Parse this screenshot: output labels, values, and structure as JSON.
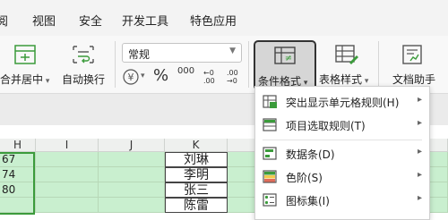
{
  "menu": {
    "items": [
      {
        "label": "阅"
      },
      {
        "label": "视图"
      },
      {
        "label": "安全"
      },
      {
        "label": "开发工具"
      },
      {
        "label": "特色应用"
      }
    ]
  },
  "ribbon": {
    "merge_label": "合并居中",
    "wrap_label": "自动换行",
    "number_format": "常规",
    "currency_symbol": "¥",
    "percent_symbol": "%",
    "thousands_symbol": "000",
    "cond_format_label": "条件格式",
    "table_style_label": "表格样式",
    "doc_helper_label": "文档助手"
  },
  "sheet": {
    "columns": [
      "H",
      "I",
      "J",
      "K"
    ],
    "colH": [
      "67",
      "74",
      "80",
      ""
    ],
    "colK": [
      "刘琳",
      "李明",
      "张三",
      "陈雷"
    ]
  },
  "dropdown": {
    "items": [
      {
        "label": "突出显示单元格规则(H)",
        "icon": "highlight-rules-icon"
      },
      {
        "label": "项目选取规则(T)",
        "icon": "top-bottom-rules-icon"
      },
      {
        "label": "数据条(D)",
        "icon": "data-bars-icon"
      },
      {
        "label": "色阶(S)",
        "icon": "color-scales-icon"
      },
      {
        "label": "图标集(I)",
        "icon": "icon-sets-icon"
      }
    ]
  },
  "colors": {
    "accent_green": "#3b9b3b",
    "cell_fill": "#c9efcf",
    "cell_border": "#b7d8b7"
  }
}
